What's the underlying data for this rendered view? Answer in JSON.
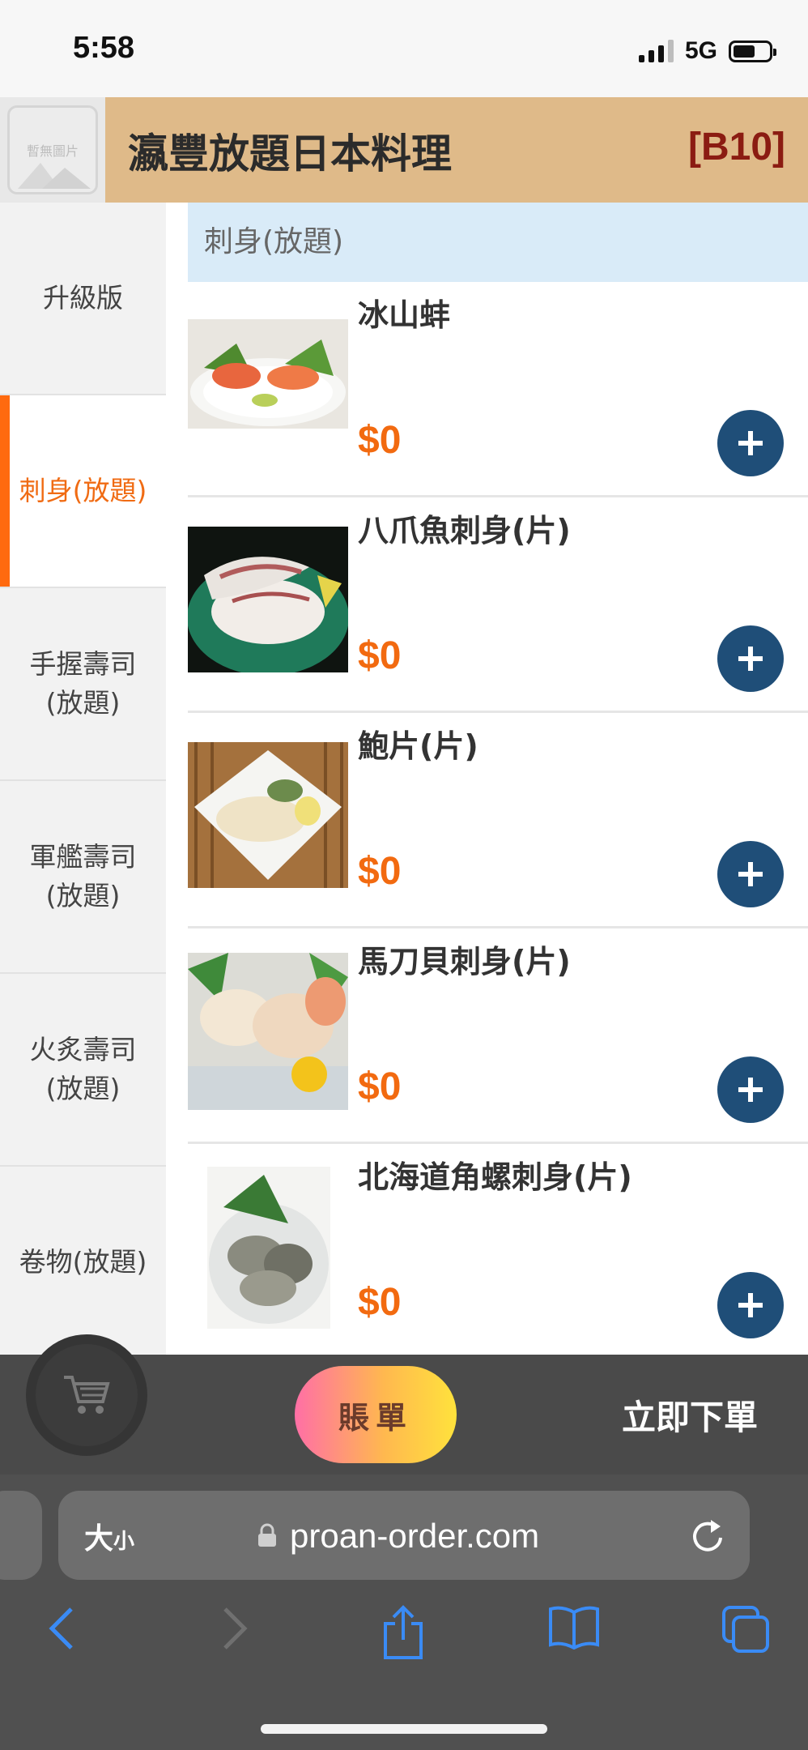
{
  "status_bar": {
    "time": "5:58",
    "network": "5G"
  },
  "header": {
    "shop_name": "瀛豐放題日本料理",
    "table_code": "[B10]",
    "logo_placeholder": "暫無圖片"
  },
  "sidebar": {
    "items": [
      {
        "label": "升級版",
        "active": false
      },
      {
        "label": "刺身(放題)",
        "active": true
      },
      {
        "label": "手握壽司\n(放題)",
        "active": false
      },
      {
        "label": "軍艦壽司\n(放題)",
        "active": false
      },
      {
        "label": "火炙壽司\n(放題)",
        "active": false
      },
      {
        "label": "卷物(放題)",
        "active": false
      }
    ]
  },
  "content": {
    "category_title": "刺身(放題)",
    "items": [
      {
        "name": "冰山蚌",
        "price": "$0"
      },
      {
        "name": "八爪魚刺身(片)",
        "price": "$0"
      },
      {
        "name": "鮑片(片)",
        "price": "$0"
      },
      {
        "name": "馬刀貝刺身(片)",
        "price": "$0"
      },
      {
        "name": "北海道角螺刺身(片)",
        "price": "$0"
      }
    ]
  },
  "order_bar": {
    "bill_label": "賬單",
    "submit_label": "立即下單"
  },
  "browser": {
    "text_size_label": "大",
    "text_size_small": "小",
    "url": "proan-order.com"
  },
  "colors": {
    "accent": "#f26a10",
    "header_bg": "#dfba89",
    "add_button": "#1f4e78",
    "table_code": "#8b1c12"
  }
}
